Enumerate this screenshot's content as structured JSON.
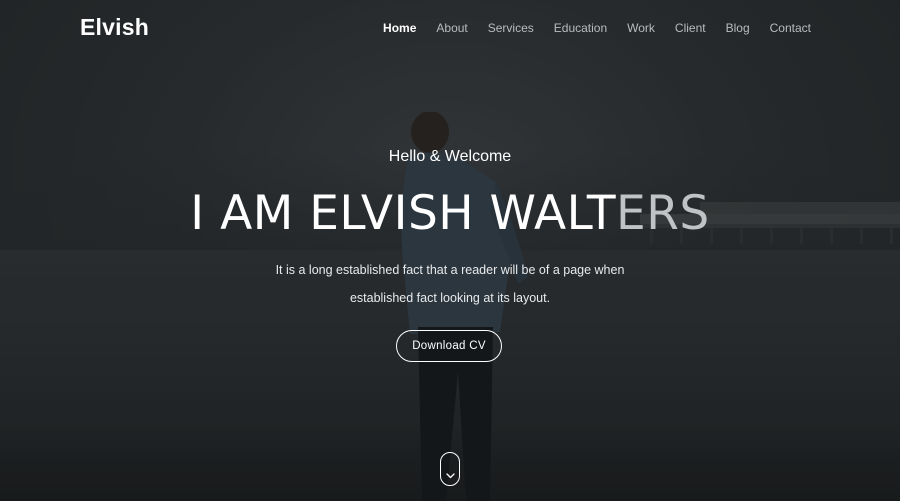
{
  "navbar": {
    "brand": "Elvish",
    "items": [
      {
        "label": "Home",
        "active": true
      },
      {
        "label": "About",
        "active": false
      },
      {
        "label": "Services",
        "active": false
      },
      {
        "label": "Education",
        "active": false
      },
      {
        "label": "Work",
        "active": false
      },
      {
        "label": "Client",
        "active": false
      },
      {
        "label": "Blog",
        "active": false
      },
      {
        "label": "Contact",
        "active": false
      }
    ]
  },
  "hero": {
    "greeting": "Hello & Welcome",
    "headline_main": "I AM ELVISH WALT",
    "headline_faded": "ERS",
    "description_line1": "It is a long established fact that a reader will be of a page when",
    "description_line2": "established fact looking at its layout.",
    "cta_label": "Download CV",
    "scroll_icon": "chevron-down-icon"
  },
  "colors": {
    "overlay": "#2a2d30",
    "text": "#ffffff",
    "nav_inactive": "#b9bcbe"
  }
}
